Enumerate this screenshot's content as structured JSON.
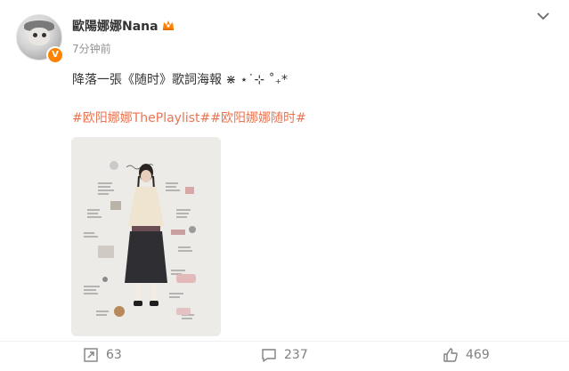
{
  "post": {
    "username": "歐陽娜娜Nana",
    "time_ago": "7分钟前",
    "verified_badge": "V",
    "text": "降落一張《随时》歌詞海報 ⋇ ⋆˙⊹ ˚₊*",
    "hashtags": "#欧阳娜娜ThePlaylist##欧阳娜娜随时#"
  },
  "actions": {
    "repost_count": "63",
    "comment_count": "237",
    "like_count": "469"
  },
  "icons": {
    "crown": "crown-icon",
    "expand": "chevron-down-icon",
    "repost": "repost-icon",
    "comment": "comment-icon",
    "like": "thumbs-up-icon"
  },
  "colors": {
    "hashtag": "#eb7350",
    "badge": "#ff8200",
    "muted": "#939393"
  }
}
